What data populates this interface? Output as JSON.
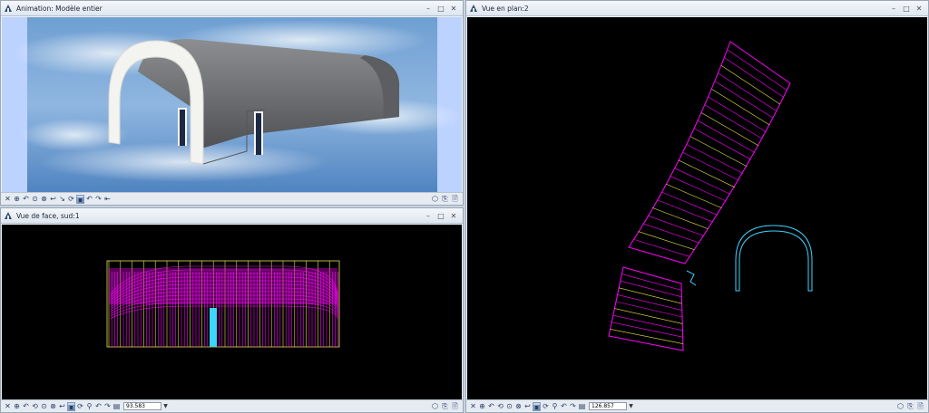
{
  "windows": {
    "animation": {
      "title": "Animation: Modèle entier",
      "controls": [
        "–",
        "□",
        "✕"
      ]
    },
    "front_view": {
      "title": "Vue de face, sud:1",
      "controls": [
        "–",
        "□",
        "✕"
      ],
      "zoom_value": "93.583"
    },
    "plan_view": {
      "title": "Vue en plan:2",
      "controls": [
        "–",
        "□",
        "✕"
      ],
      "zoom_value": "126.857"
    }
  },
  "toolbar_icons": {
    "animation": [
      "✕",
      "⊕",
      "↶",
      "⊙",
      "⊗",
      "↩",
      "↘",
      "⟳",
      "▣",
      "↶",
      "↷",
      "⇤"
    ],
    "front_view": [
      "✕",
      "⊕",
      "↶",
      "⟲",
      "⊙",
      "⊗",
      "↩",
      "▣",
      "⟳",
      "⚲",
      "↶",
      "↷",
      "▤"
    ],
    "plan_view": [
      "✕",
      "⊕",
      "↶",
      "⟲",
      "⊙",
      "⊗",
      "↩",
      "▣",
      "⟳",
      "⚲",
      "↶",
      "↷",
      "▤"
    ],
    "right_icons": [
      "⬡",
      "⎘",
      "🗎"
    ]
  },
  "colors": {
    "model_gray": "#6d6f72",
    "wireframe_magenta": "#ff00ff",
    "wireframe_yellow": "#e9e04f",
    "cyan": "#3fd3ff",
    "sky_top": "#5a8cc6",
    "sky_bottom": "#9dc0e6",
    "side_panel": "#bcd2ff"
  }
}
